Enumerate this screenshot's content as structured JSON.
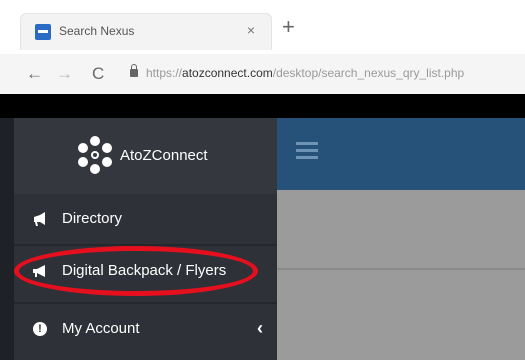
{
  "browser": {
    "tab": {
      "title": "Search Nexus",
      "close_glyph": "×"
    },
    "new_tab_glyph": "+",
    "nav": {
      "back_glyph": "←",
      "forward_glyph": "→",
      "reload_glyph": "C"
    },
    "url": {
      "scheme": "https://",
      "host": "atozconnect.com",
      "path": "/desktop/search_nexus_qry_list.php"
    }
  },
  "sidebar": {
    "brand": {
      "name": "AtoZConnect",
      "logo_icon": "flower-logo-icon"
    },
    "items": [
      {
        "label": "Directory",
        "icon": "bullhorn-icon"
      },
      {
        "label": "Digital Backpack / Flyers",
        "icon": "megaphone-icon"
      },
      {
        "label": "My Account",
        "icon": "info-circle-icon",
        "icon_glyph": "!",
        "chevron": "‹"
      }
    ]
  },
  "annotation": {
    "highlight_color": "#e60f1e",
    "highlighted_item": "Digital Backpack / Flyers"
  },
  "colors": {
    "sidebar_bg": "#2e3238",
    "topbar_bg": "#26527a",
    "content_bg": "#9b9b9b"
  }
}
